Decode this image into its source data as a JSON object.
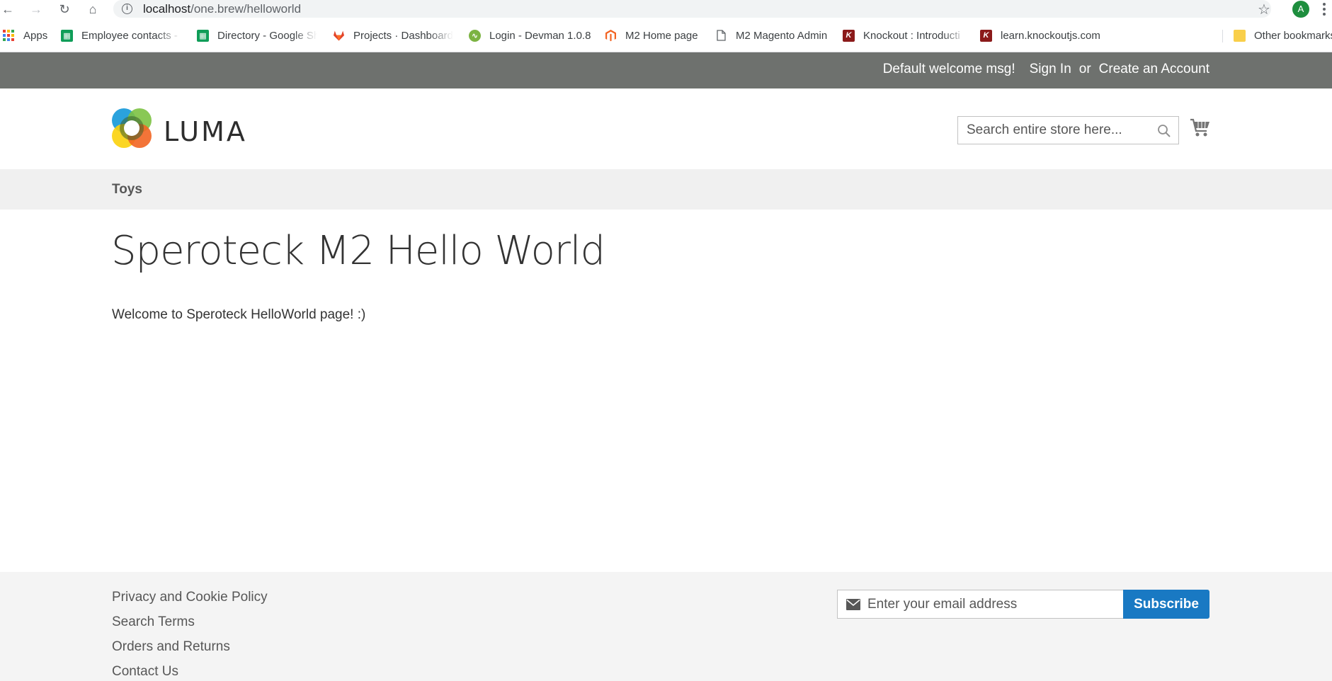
{
  "browser": {
    "url_host": "localhost",
    "url_path": "/one.brew/helloworld",
    "profile_initial": "A",
    "nav_icons": [
      "back-icon",
      "forward-icon",
      "reload-icon",
      "home-icon"
    ],
    "bookmarks": [
      {
        "label": "Apps",
        "icon": "apps-grid-icon"
      },
      {
        "label": "Employee contacts - G",
        "icon": "google-sheets-icon",
        "color": "#0f9d58"
      },
      {
        "label": "Directory - Google Sh",
        "icon": "google-sheets-icon",
        "color": "#0f9d58"
      },
      {
        "label": "Projects · Dashboard",
        "icon": "gitlab-icon",
        "color": "#e24329"
      },
      {
        "label": "Login - Devman 1.0.8",
        "icon": "devman-icon",
        "color": "#7cb342"
      },
      {
        "label": "M2 Home page",
        "icon": "magento-icon",
        "color": "#f26322"
      },
      {
        "label": "M2 Magento Admin",
        "icon": "page-icon"
      },
      {
        "label": "Knockout : Introducti",
        "icon": "knockout-icon",
        "color": "#8b1a1a"
      },
      {
        "label": "learn.knockoutjs.com",
        "icon": "knockout-icon",
        "color": "#8b1a1a"
      },
      {
        "label": "Other bookmarks",
        "icon": "folder-icon",
        "color": "#f9cf4a"
      }
    ]
  },
  "header": {
    "welcome": "Default welcome msg!",
    "sign_in": "Sign In",
    "or": "or",
    "create_account": "Create an Account",
    "logo_text": "LUMA",
    "search_placeholder": "Search entire store here...",
    "nav_items": [
      "Toys"
    ]
  },
  "main": {
    "title": "Speroteck M2 Hello World",
    "body": "Welcome to Speroteck HelloWorld page! :)"
  },
  "footer": {
    "links": [
      "Privacy and Cookie Policy",
      "Search Terms",
      "Orders and Returns",
      "Contact Us"
    ],
    "newsletter_placeholder": "Enter your email address",
    "subscribe_label": "Subscribe"
  },
  "colors": {
    "panel": "#6e716e",
    "accent_button": "#1979c3",
    "nav_bg": "#f0f0f0",
    "footer_bg": "#f4f4f4"
  }
}
